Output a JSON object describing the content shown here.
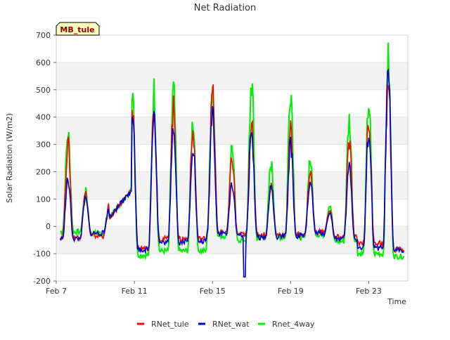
{
  "chart_data": {
    "type": "line",
    "title": "Net Radiation",
    "xlabel": "Time",
    "ylabel": "Solar Radiation (W/m2)",
    "ylim": [
      -200,
      700
    ],
    "xlim_days": [
      7,
      25
    ],
    "y_ticks": [
      -200,
      -100,
      0,
      100,
      200,
      300,
      400,
      500,
      600,
      700
    ],
    "x_tick_labels": [
      "Feb 7",
      "Feb 11",
      "Feb 15",
      "Feb 19",
      "Feb 23"
    ],
    "x_tick_days": [
      7,
      11,
      15,
      19,
      23
    ],
    "grid": "horizontal bands",
    "legend_position": "bottom",
    "annotation": "MB_tule",
    "colors": {
      "RNet_tule": "#ff0000",
      "RNet_wat": "#0000cc",
      "Rnet_4way": "#00ee00"
    },
    "night_level": {
      "RNet_tule": [
        -40,
        -35,
        -60,
        -80,
        -45,
        -45,
        -20,
        -30,
        -30,
        -30,
        -20,
        -40,
        -60,
        -85
      ],
      "RNet_wat": [
        -45,
        -25,
        -55,
        -85,
        -60,
        -55,
        -25,
        -30,
        -40,
        -35,
        -25,
        -45,
        -80,
        -85
      ],
      "Rnet_4way": [
        -20,
        -25,
        -90,
        -105,
        -90,
        -90,
        -35,
        -50,
        -40,
        -40,
        -30,
        -55,
        -100,
        -110
      ]
    },
    "daily_peaks": {
      "days": [
        7.6,
        8.5,
        9.7,
        10.9,
        12.0,
        13.0,
        14.0,
        15.0,
        16.0,
        17.0,
        18.0,
        19.0,
        20.0,
        21.0,
        22.0,
        23.0,
        24.0
      ],
      "RNet_tule": [
        300,
        120,
        80,
        420,
        430,
        430,
        340,
        490,
        250,
        400,
        150,
        350,
        200,
        60,
        300,
        380,
        540
      ],
      "RNet_wat": [
        170,
        100,
        70,
        440,
        440,
        380,
        300,
        430,
        160,
        350,
        150,
        300,
        170,
        50,
        220,
        350,
        550
      ],
      "Rnet_4way": [
        340,
        130,
        80,
        525,
        495,
        495,
        390,
        515,
        295,
        525,
        230,
        510,
        245,
        80,
        390,
        455,
        605
      ]
    },
    "series": [
      {
        "name": "RNet_tule",
        "color": "#ff0000"
      },
      {
        "name": "RNet_wat",
        "color": "#0000cc"
      },
      {
        "name": "Rnet_4way",
        "color": "#00ee00"
      }
    ]
  }
}
